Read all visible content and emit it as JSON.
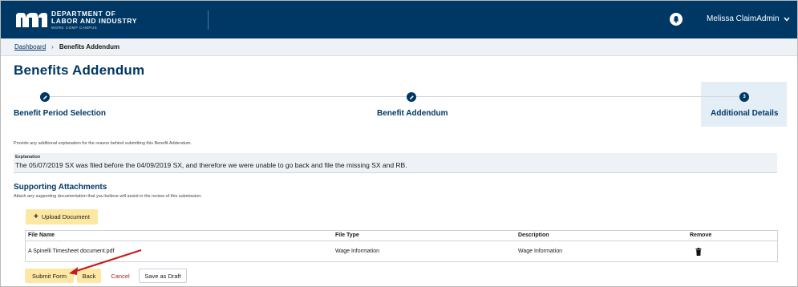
{
  "header": {
    "logo_line1": "DEPARTMENT OF",
    "logo_line2": "LABOR AND INDUSTRY",
    "logo_line3": "WORK COMP CAMPUS",
    "user_name": "Melissa ClaimAdmin"
  },
  "breadcrumb": {
    "home": "Dashboard",
    "separator": "›",
    "current": "Benefits Addendum"
  },
  "page_title": "Benefits Addendum",
  "steps": [
    {
      "label": "Benefit Period Selection",
      "state": "complete"
    },
    {
      "label": "Benefit Addendum",
      "state": "complete"
    },
    {
      "label": "Additional Details",
      "state": "current",
      "number": "3"
    }
  ],
  "instruction": "Provide any additional explanation for the reason behind submitting this Benefit Addendum.",
  "explanation": {
    "label": "Explanation",
    "value": "The 05/07/2019 SX was filed before the 04/09/2019 SX, and therefore we were unable to go back and file the missing SX and RB."
  },
  "attachments": {
    "title": "Supporting Attachments",
    "subtitle": "Attach any supporting documentation that you believe will assist in the review of this submission.",
    "upload_label": "Upload Document",
    "columns": [
      "File Name",
      "File Type",
      "Description",
      "Remove"
    ],
    "rows": [
      {
        "file_name": "A Spinelli Timesheet document.pdf",
        "file_type": "Wage Information",
        "description": "Wage Information"
      }
    ]
  },
  "actions": {
    "submit": "Submit Form",
    "back": "Back",
    "cancel": "Cancel",
    "save_draft": "Save as Draft"
  },
  "colors": {
    "header_bg": "#003865",
    "accent_button": "#fde8a3",
    "cancel_text": "#b01f1f",
    "annotation_arrow": "#c41e1e"
  },
  "icons": {
    "complete_step": "pencil-icon",
    "remove": "trash-icon",
    "user_menu": "chevron-down-icon",
    "notifications": "bell-icon",
    "upload": "plus-icon"
  }
}
